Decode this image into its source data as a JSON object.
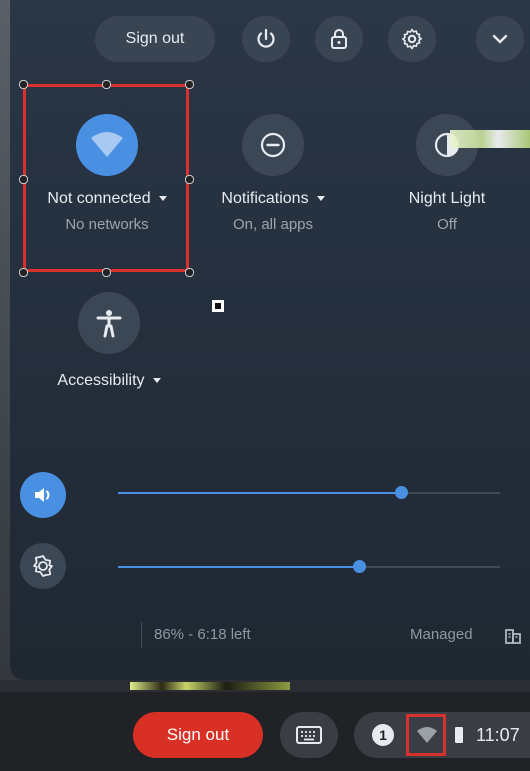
{
  "quick_settings": {
    "sign_out_label": "Sign out",
    "top_icons": [
      "power-icon",
      "lock-icon",
      "gear-icon",
      "chevron-down-icon"
    ],
    "tiles": {
      "network": {
        "label": "Not connected",
        "sub": "No networks",
        "icon": "wifi-icon"
      },
      "notifications": {
        "label": "Notifications",
        "sub": "On, all apps",
        "icon": "do-not-disturb-icon"
      },
      "night_light": {
        "label": "Night Light",
        "sub": "Off",
        "icon": "night-light-icon"
      },
      "accessibility": {
        "label": "Accessibility",
        "icon": "accessibility-icon"
      }
    },
    "volume_level": 0.74,
    "brightness_level": 0.63,
    "battery_text": "86% - 6:18 left",
    "managed_label": "Managed"
  },
  "shelf": {
    "sign_out_label": "Sign out",
    "notification_count": "1",
    "time": "11:07"
  },
  "colors": {
    "accent": "#4a90e2",
    "highlight": "#d9302e",
    "panel": "#263140"
  }
}
